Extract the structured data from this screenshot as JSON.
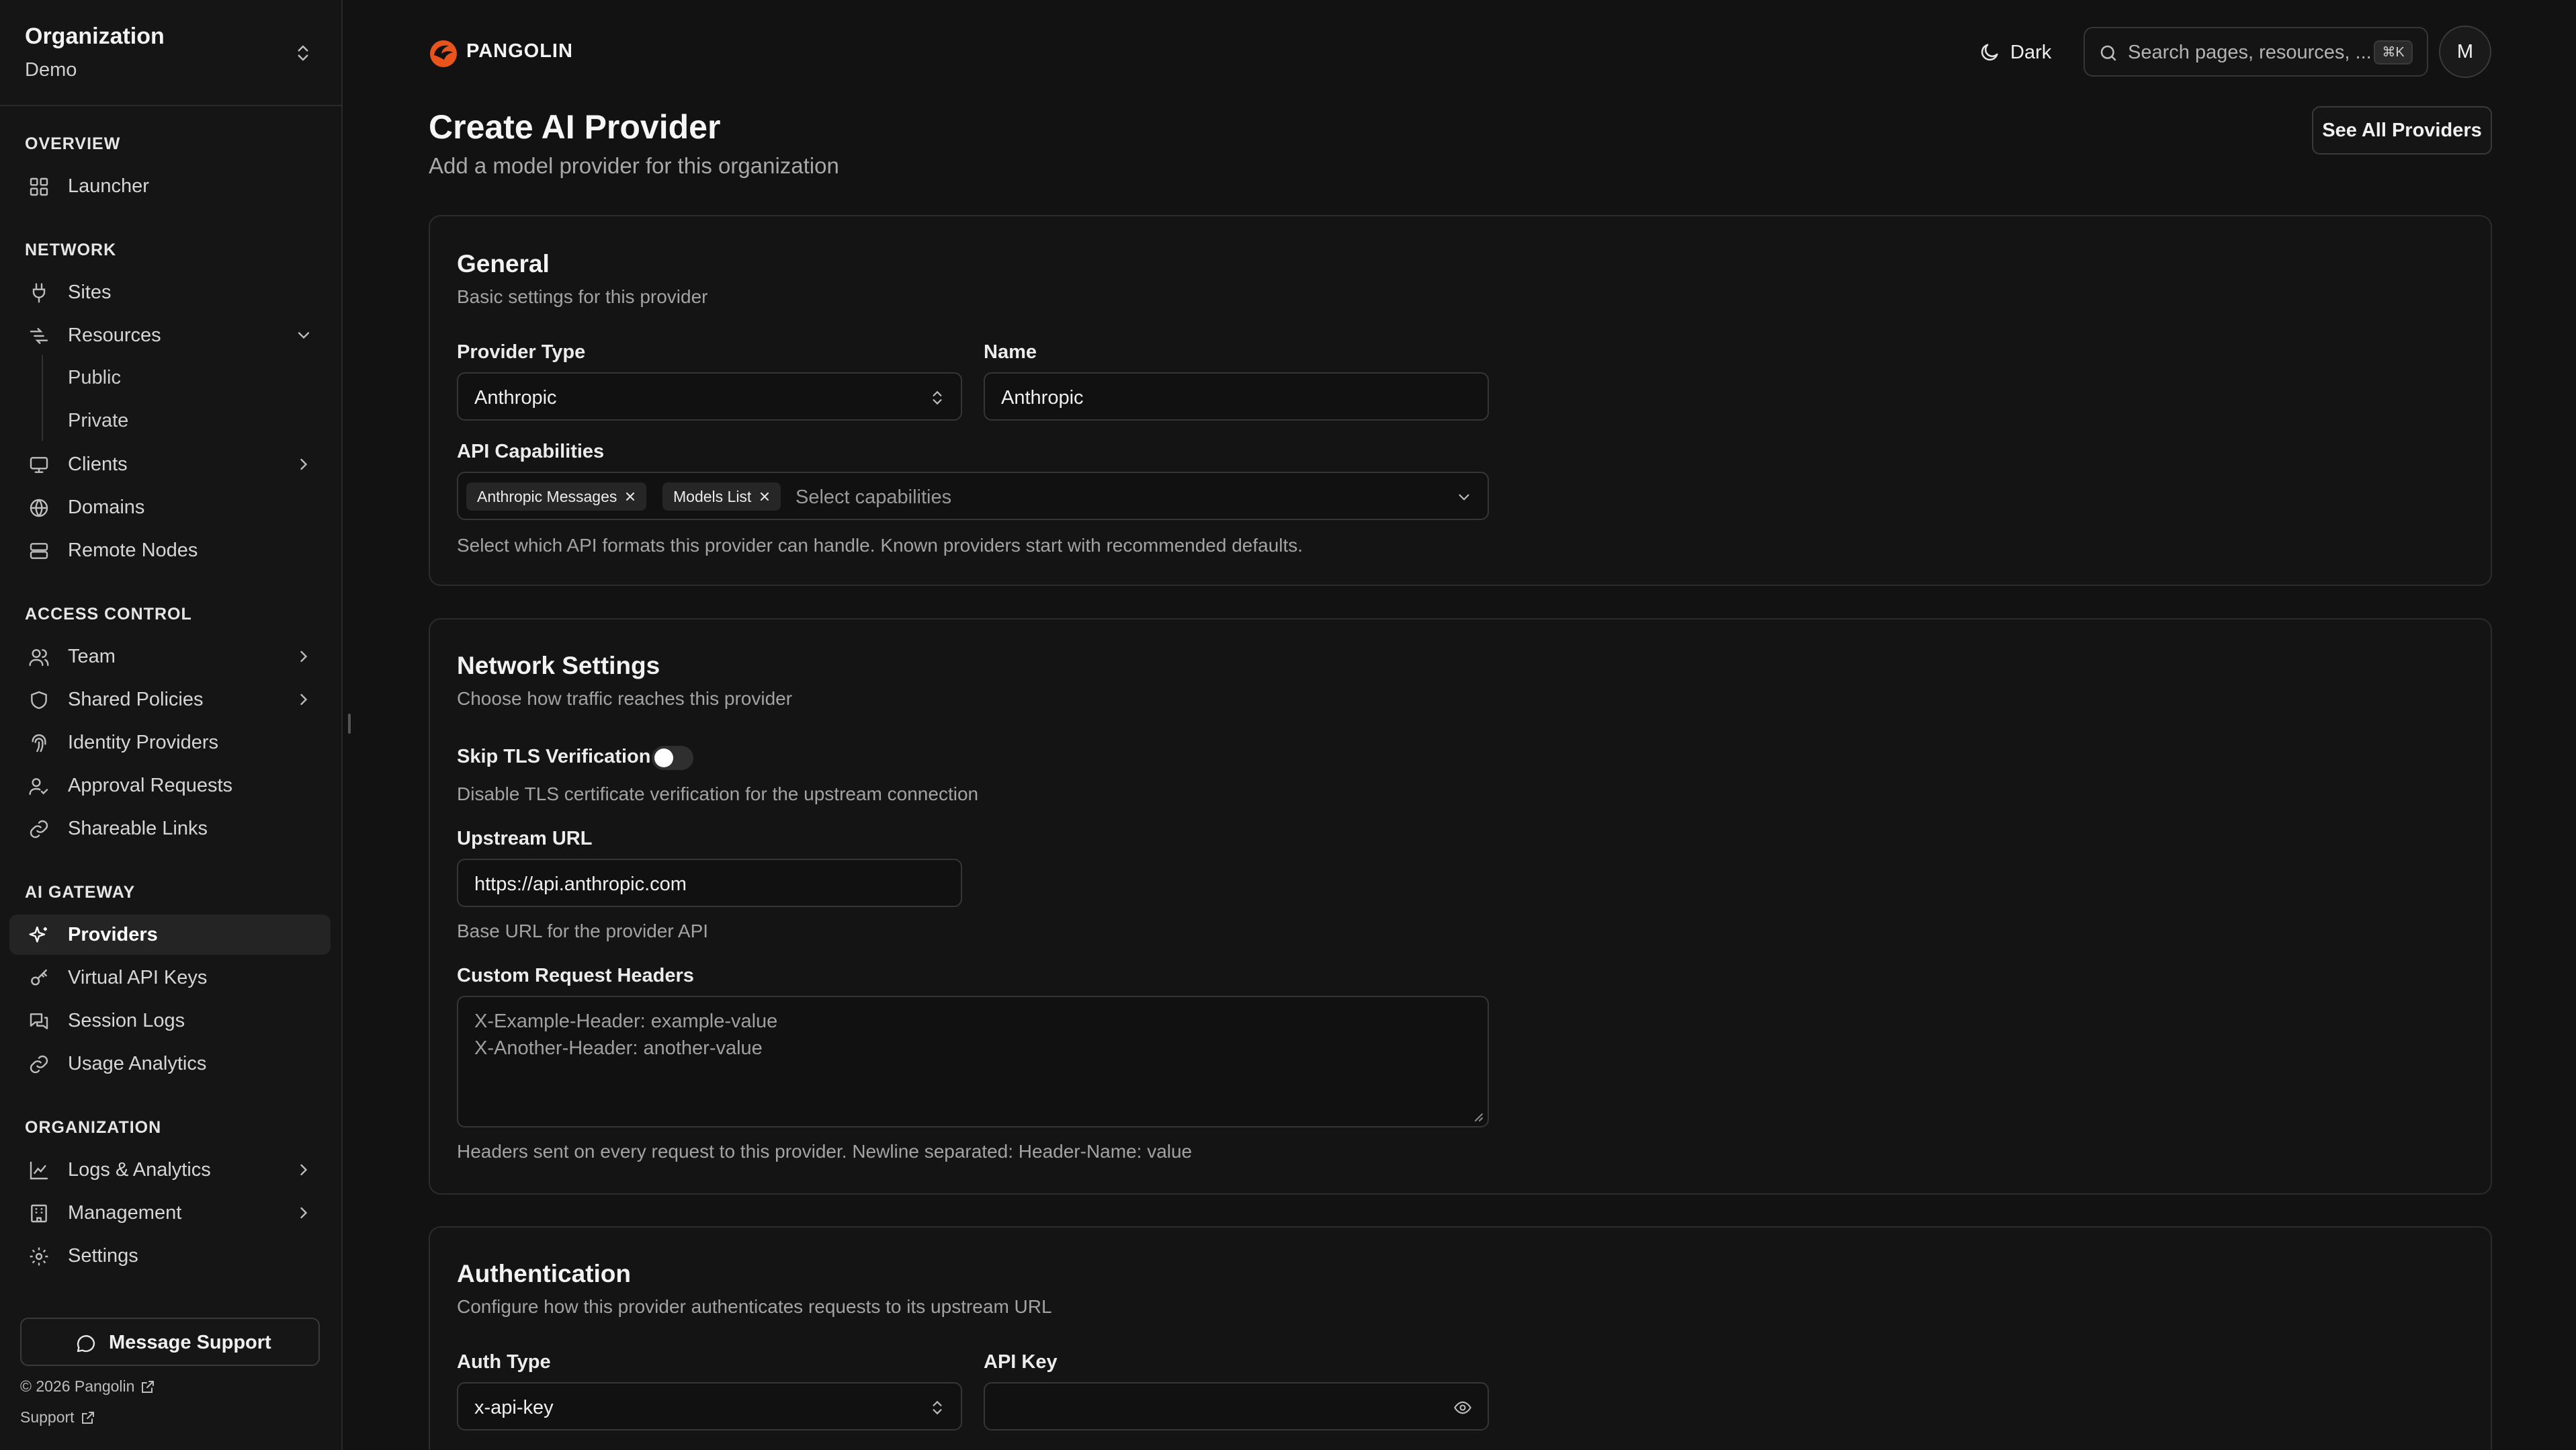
{
  "sidebar": {
    "org_title": "Organization",
    "org_name": "Demo",
    "sections": {
      "overview": "OVERVIEW",
      "network": "NETWORK",
      "access_control": "ACCESS CONTROL",
      "ai_gateway": "AI GATEWAY",
      "organization": "ORGANIZATION"
    },
    "items": {
      "launcher": "Launcher",
      "sites": "Sites",
      "resources": "Resources",
      "public": "Public",
      "private": "Private",
      "clients": "Clients",
      "domains": "Domains",
      "remote_nodes": "Remote Nodes",
      "team": "Team",
      "shared_policies": "Shared Policies",
      "identity_providers": "Identity Providers",
      "approval_requests": "Approval Requests",
      "shareable_links": "Shareable Links",
      "providers": "Providers",
      "virtual_api_keys": "Virtual API Keys",
      "session_logs": "Session Logs",
      "usage_analytics": "Usage Analytics",
      "logs_analytics": "Logs & Analytics",
      "management": "Management",
      "settings": "Settings"
    },
    "active_item": "providers",
    "message_support": "Message Support",
    "copyright": "© 2026 Pangolin",
    "support": "Support"
  },
  "topbar": {
    "brand": "PANGOLIN",
    "theme_label": "Dark",
    "search_placeholder": "Search pages, resources, ...",
    "search_shortcut": "⌘K",
    "avatar_initial": "M"
  },
  "header": {
    "title": "Create AI Provider",
    "subtitle": "Add a model provider for this organization",
    "see_all_button": "See All Providers"
  },
  "general": {
    "title": "General",
    "description": "Basic settings for this provider",
    "provider_type_label": "Provider Type",
    "provider_type_value": "Anthropic",
    "name_label": "Name",
    "name_value": "Anthropic",
    "capabilities_label": "API Capabilities",
    "capabilities_selected": [
      "Anthropic Messages",
      "Models List"
    ],
    "capabilities_placeholder": "Select capabilities",
    "capabilities_hint": "Select which API formats this provider can handle. Known providers start with recommended defaults."
  },
  "network": {
    "title": "Network Settings",
    "description": "Choose how traffic reaches this provider",
    "skip_tls_label": "Skip TLS Verification",
    "skip_tls_enabled": false,
    "skip_tls_hint": "Disable TLS certificate verification for the upstream connection",
    "upstream_url_label": "Upstream URL",
    "upstream_url_value": "https://api.anthropic.com",
    "upstream_url_hint": "Base URL for the provider API",
    "headers_label": "Custom Request Headers",
    "headers_placeholder_line1": "X-Example-Header: example-value",
    "headers_placeholder_line2": "X-Another-Header: another-value",
    "headers_hint": "Headers sent on every request to this provider. Newline separated: Header-Name: value"
  },
  "auth": {
    "title": "Authentication",
    "description": "Configure how this provider authenticates requests to its upstream URL",
    "auth_type_label": "Auth Type",
    "auth_type_value": "x-api-key",
    "api_key_label": "API Key",
    "api_key_value": ""
  }
}
